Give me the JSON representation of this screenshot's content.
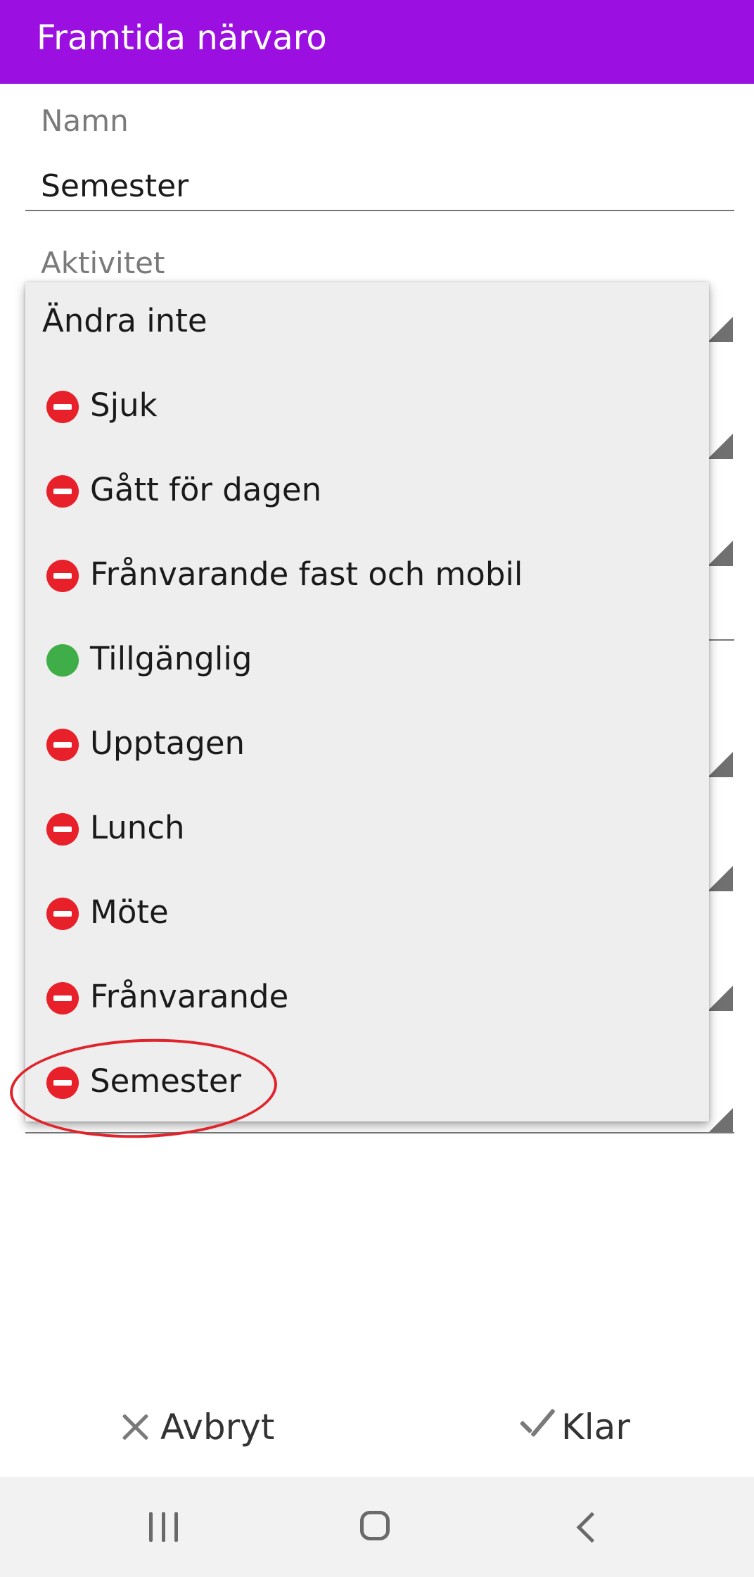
{
  "appbar": {
    "title": "Framtida närvaro"
  },
  "form": {
    "name_label": "Namn",
    "name_value": "Semester",
    "activity_label": "Aktivitet"
  },
  "dropdown": {
    "items": [
      {
        "label": "Ändra inte",
        "status": "none"
      },
      {
        "label": "Sjuk",
        "status": "busy"
      },
      {
        "label": "Gått för dagen",
        "status": "busy"
      },
      {
        "label": "Frånvarande fast och mobil",
        "status": "busy"
      },
      {
        "label": "Tillgänglig",
        "status": "available"
      },
      {
        "label": "Upptagen",
        "status": "busy"
      },
      {
        "label": "Lunch",
        "status": "busy"
      },
      {
        "label": "Möte",
        "status": "busy"
      },
      {
        "label": "Frånvarande",
        "status": "busy"
      },
      {
        "label": "Semester",
        "status": "busy"
      }
    ],
    "highlighted_item": "Semester"
  },
  "footer": {
    "cancel_label": "Avbryt",
    "done_label": "Klar"
  },
  "colors": {
    "appbar": "#9b10e0",
    "busy": "#e8202a",
    "available": "#3fae48",
    "highlight": "#e0242c"
  },
  "icons": {
    "cancel": "close-icon",
    "done": "check-icon",
    "nav_recent": "recent-apps-icon",
    "nav_home": "home-icon",
    "nav_back": "back-icon"
  }
}
